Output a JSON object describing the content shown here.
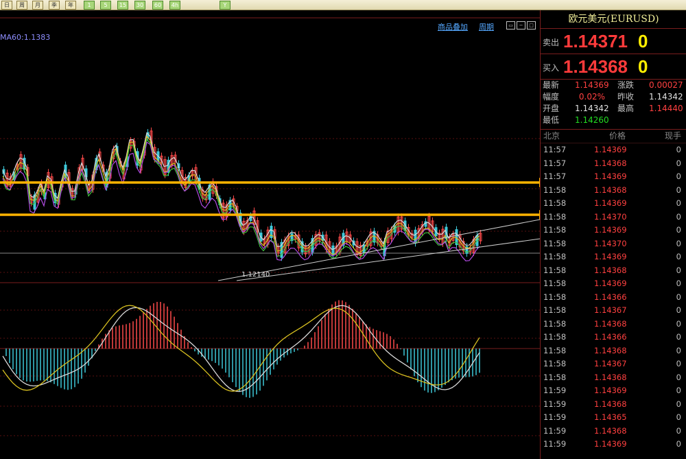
{
  "toolbar": {
    "buttons": [
      "日",
      "周",
      "月",
      "季",
      "年",
      "1",
      "5",
      "15",
      "30",
      "60",
      "4h",
      "Y"
    ]
  },
  "chart": {
    "links": {
      "overlay": "商品叠加",
      "period": "周期"
    },
    "ma_label": "MA60:1.1383",
    "low_label": "1.12140",
    "colors": {
      "up": "#ff4a4a",
      "down": "#3ec8d8",
      "arrow": "#ffb300",
      "ma_white": "#d8d8d8",
      "ma_yellow": "#d8c020",
      "ma_green": "#3fbf3f",
      "ma_purple": "#b04ae0"
    }
  },
  "panel": {
    "title": "欧元美元(EURUSD)",
    "sell": {
      "label": "卖出",
      "price": "1.14371",
      "vol": "0"
    },
    "buy": {
      "label": "买入",
      "price": "1.14368",
      "vol": "0"
    },
    "stats": {
      "latest_label": "最新",
      "latest": "1.14369",
      "change_label": "涨跌",
      "change": "0.00027",
      "range_label": "幅度",
      "range": "0.02%",
      "prevclose_label": "昨收",
      "prevclose": "1.14342",
      "open_label": "开盘",
      "open": "1.14342",
      "high_label": "最高",
      "high": "1.14440",
      "low_label": "最低",
      "low": "1.14260"
    },
    "tick_header": {
      "time": "北京",
      "price": "价格",
      "vol": "现手"
    },
    "ticks": [
      [
        "11:57",
        "1.14369",
        "0"
      ],
      [
        "11:57",
        "1.14368",
        "0"
      ],
      [
        "11:57",
        "1.14369",
        "0"
      ],
      [
        "11:58",
        "1.14368",
        "0"
      ],
      [
        "11:58",
        "1.14369",
        "0"
      ],
      [
        "11:58",
        "1.14370",
        "0"
      ],
      [
        "11:58",
        "1.14369",
        "0"
      ],
      [
        "11:58",
        "1.14370",
        "0"
      ],
      [
        "11:58",
        "1.14369",
        "0"
      ],
      [
        "11:58",
        "1.14368",
        "0"
      ],
      [
        "11:58",
        "1.14369",
        "0"
      ],
      [
        "11:58",
        "1.14366",
        "0"
      ],
      [
        "11:58",
        "1.14367",
        "0"
      ],
      [
        "11:58",
        "1.14368",
        "0"
      ],
      [
        "11:58",
        "1.14366",
        "0"
      ],
      [
        "11:58",
        "1.14368",
        "0"
      ],
      [
        "11:58",
        "1.14367",
        "0"
      ],
      [
        "11:58",
        "1.14368",
        "0"
      ],
      [
        "11:59",
        "1.14369",
        "0"
      ],
      [
        "11:59",
        "1.14368",
        "0"
      ],
      [
        "11:59",
        "1.14365",
        "0"
      ],
      [
        "11:59",
        "1.14368",
        "0"
      ],
      [
        "11:59",
        "1.14369",
        "0"
      ]
    ]
  }
}
